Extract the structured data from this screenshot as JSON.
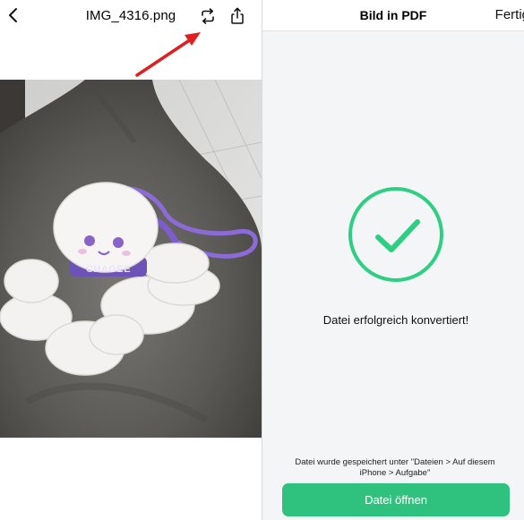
{
  "left": {
    "file_name": "IMG_4316.png",
    "icons": {
      "back": "chevron-left-icon",
      "convert": "convert-arrows-icon",
      "share": "share-icon",
      "annotation": "red-arrow-annotation"
    },
    "photo": {
      "keychain_text": "CHAGEE"
    }
  },
  "right": {
    "title": "Bild in PDF",
    "done_label": "Fertig",
    "success_message": "Datei erfolgreich konvertiert!",
    "saved_info": "Datei wurde gespeichert unter \"Dateien > Auf diesem iPhone > Aufgabe\"",
    "open_button_label": "Datei öffnen",
    "icons": {
      "success": "checkmark-circle-icon"
    }
  },
  "colors": {
    "accent_green": "#2ec27e",
    "check_green": "#2ecf83",
    "annotation_red": "#e02020"
  }
}
